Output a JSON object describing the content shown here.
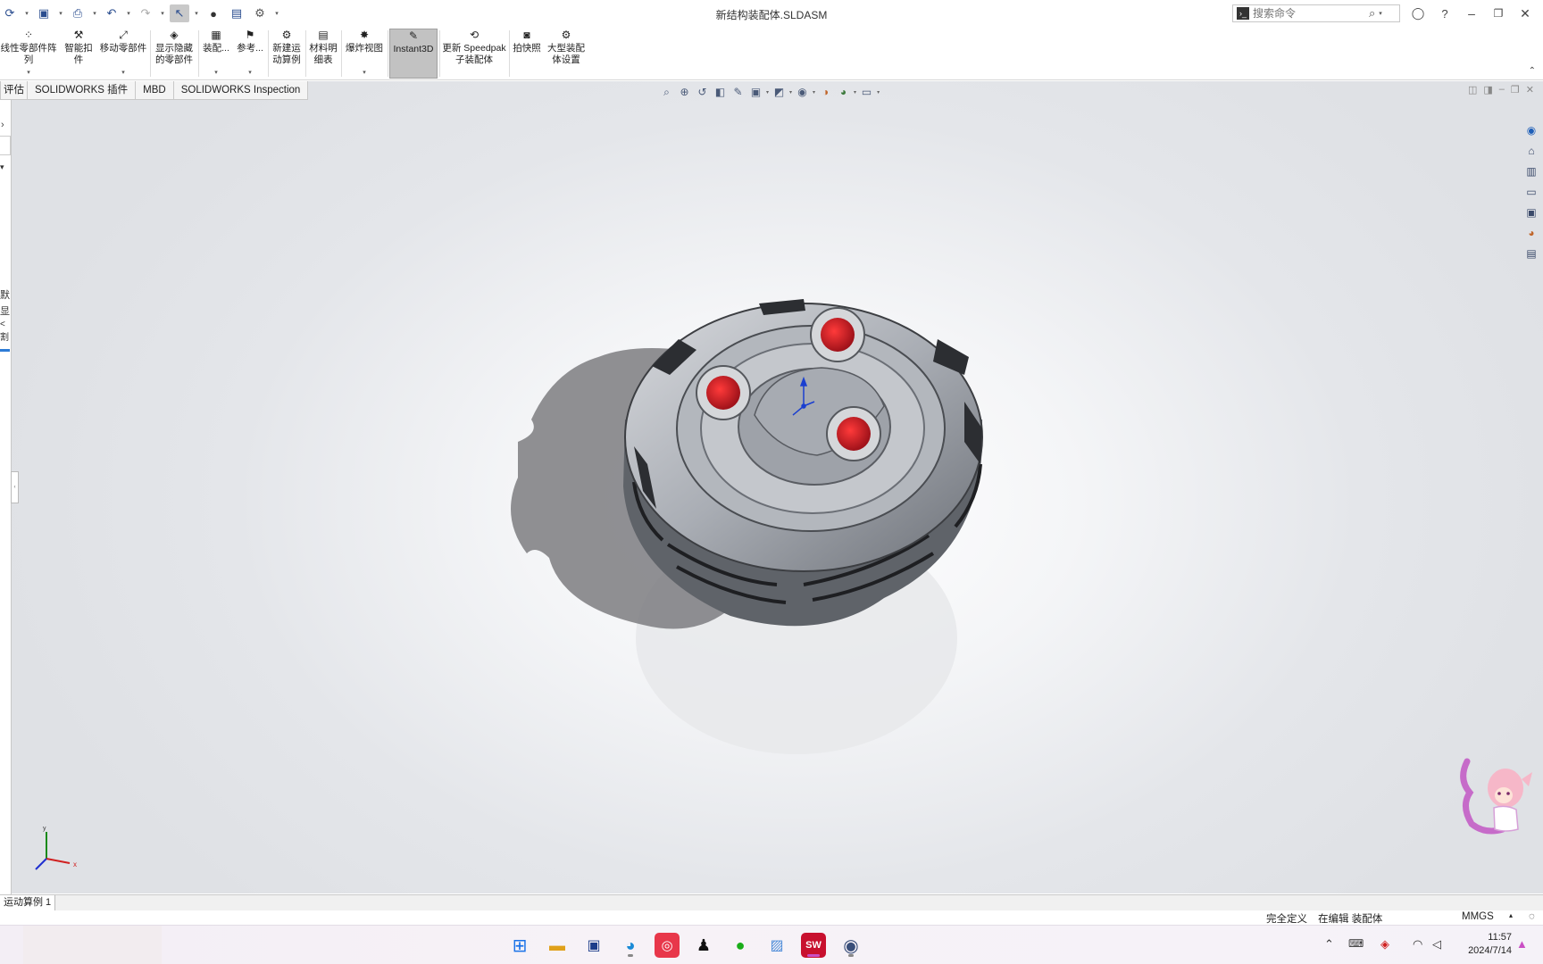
{
  "titlebar": {
    "doc_title": "新结构装配体.SLDASM",
    "search_placeholder": "搜索命令"
  },
  "ribbon": {
    "buttons": [
      {
        "label": "线性零部件阵列",
        "icon": "pattern-icon"
      },
      {
        "label": "智能扣\n件",
        "icon": "smart-fastener-icon"
      },
      {
        "label": "移动零部件",
        "icon": "move-component-icon"
      },
      {
        "label": "显示隐藏\n的零部件",
        "icon": "show-hidden-icon"
      },
      {
        "label": "装配...",
        "icon": "assembly-features-icon"
      },
      {
        "label": "参考...",
        "icon": "reference-geometry-icon"
      },
      {
        "label": "新建运\n动算例",
        "icon": "motion-study-icon"
      },
      {
        "label": "材料明\n细表",
        "icon": "bom-icon"
      },
      {
        "label": "爆炸视图",
        "icon": "explode-icon"
      },
      {
        "label": "Instant3D",
        "icon": "instant3d-icon"
      },
      {
        "label": "更新 Speedpak\n子装配体",
        "icon": "speedpak-icon"
      },
      {
        "label": "拍快照",
        "icon": "snapshot-icon"
      },
      {
        "label": "大型装配\n体设置",
        "icon": "large-assembly-icon"
      }
    ]
  },
  "tabs": [
    "评估",
    "SOLIDWORKS 插件",
    "MBD",
    "SOLIDWORKS Inspection"
  ],
  "left_panel": {
    "fragments": [
      "默",
      "显",
      "<割"
    ]
  },
  "status": {
    "sheet_tab": "运动算例 1",
    "fully_defined": "完全定义",
    "editing": "在编辑 装配体",
    "units": "MMGS"
  },
  "clock": {
    "time": "11:57",
    "date": "2024/7/14"
  },
  "triad": {
    "x": "x",
    "y": "y"
  },
  "colors": {
    "accent_blue": "#2d7bd6",
    "hole_red": "#d8202a",
    "model_grey": "#9aa0a8",
    "ribbon_active": "#c2c2c2"
  }
}
